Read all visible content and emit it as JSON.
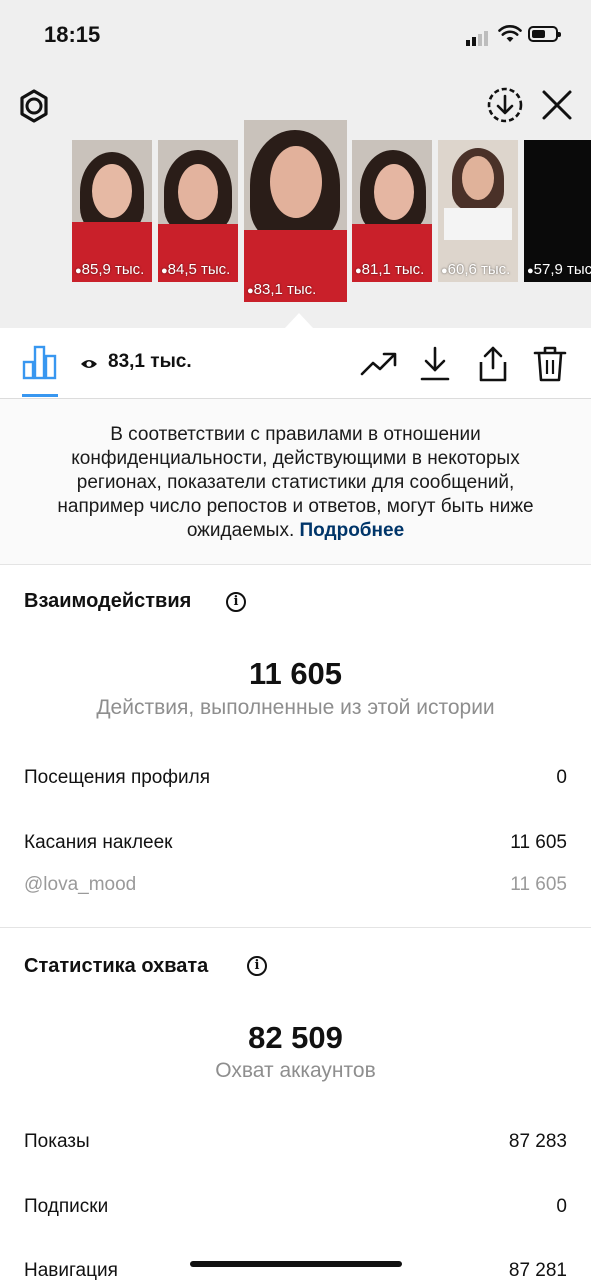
{
  "status": {
    "time": "18:15"
  },
  "thumbnails": [
    {
      "count": "85,9 тыс."
    },
    {
      "count": "84,5 тыс."
    },
    {
      "count": "83,1 тыс.",
      "selected": true
    },
    {
      "count": "81,1 тыс."
    },
    {
      "count": "60,6 тыс."
    },
    {
      "count": "57,9 тыс."
    }
  ],
  "action_bar": {
    "views": "83,1 тыс."
  },
  "notice": {
    "text": "В соответствии с правилами в отношении конфиденциальности, действующими в некоторых регионах, показатели статистики для сообщений, например число репостов и ответов, могут быть ниже ожидаемых.",
    "link": "Подробнее"
  },
  "interactions": {
    "title": "Взаимодействия",
    "total": "11 605",
    "total_label": "Действия, выполненные из этой истории",
    "rows": [
      {
        "label": "Посещения профиля",
        "value": "0"
      },
      {
        "label": "Касания наклеек",
        "value": "11 605"
      },
      {
        "label": "@lova_mood",
        "value": "11 605"
      }
    ]
  },
  "reach": {
    "title": "Статистика охвата",
    "total": "82 509",
    "total_label": "Охват аккаунтов",
    "rows": [
      {
        "label": "Показы",
        "value": "87 283"
      },
      {
        "label": "Подписки",
        "value": "0"
      },
      {
        "label": "Навигация",
        "value": "87 281"
      }
    ]
  },
  "colors": {
    "accent": "#3897f0",
    "link": "#003569",
    "muted": "#8e8e8e"
  }
}
